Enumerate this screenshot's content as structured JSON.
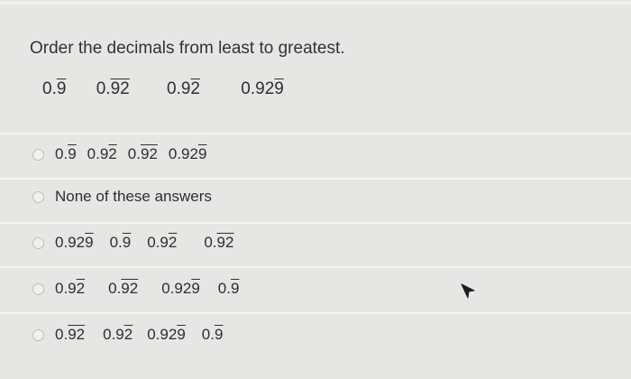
{
  "question": {
    "text": "Order the decimals from least to greatest.",
    "numbers": [
      {
        "base": "0.",
        "repeat": "9"
      },
      {
        "base": "0.",
        "repeat": "92"
      },
      {
        "base": "0.9",
        "repeat": "2"
      },
      {
        "base": "0.92",
        "repeat": "9"
      }
    ]
  },
  "options": [
    {
      "numbers": [
        {
          "base": "0.",
          "repeat": "9"
        },
        {
          "base": "0.9",
          "repeat": "2"
        },
        {
          "base": "0.",
          "repeat": "92"
        },
        {
          "base": "0.92",
          "repeat": "9"
        }
      ]
    },
    {
      "text": "None of these answers"
    },
    {
      "numbers": [
        {
          "base": "0.92",
          "repeat": "9"
        },
        {
          "base": "0.",
          "repeat": "9"
        },
        {
          "base": "0.9",
          "repeat": "2"
        },
        {
          "base": "0.",
          "repeat": "92"
        }
      ]
    },
    {
      "numbers": [
        {
          "base": "0.9",
          "repeat": "2"
        },
        {
          "base": "0.",
          "repeat": "92"
        },
        {
          "base": "0.92",
          "repeat": "9"
        },
        {
          "base": "0.",
          "repeat": "9"
        }
      ]
    },
    {
      "numbers": [
        {
          "base": "0.",
          "repeat": "92"
        },
        {
          "base": "0.9",
          "repeat": "2"
        },
        {
          "base": "0.92",
          "repeat": "9"
        },
        {
          "base": "0.",
          "repeat": "9"
        }
      ]
    }
  ],
  "icons": {
    "cursor": "arrow-cursor-icon"
  }
}
